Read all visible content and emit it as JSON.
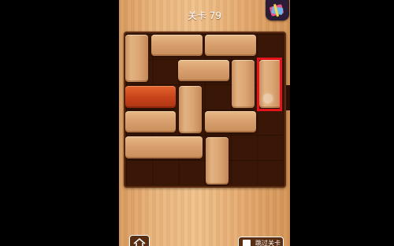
{
  "header": {
    "level_title": "关卡 79"
  },
  "top_icon": "gift-card-icon",
  "board": {
    "grid": "6x6",
    "target_block": "red-horizontal",
    "highlighted_block": "vertical-block-col6"
  },
  "bottom": {
    "left_icon": "home-icon",
    "right_icon": "video-icon",
    "right_label": "跳过关卡"
  },
  "colors": {
    "wood_light": "#e7b27a",
    "board_dark": "#3a1606",
    "red_block": "#c9441c",
    "highlight": "#e4151a"
  }
}
